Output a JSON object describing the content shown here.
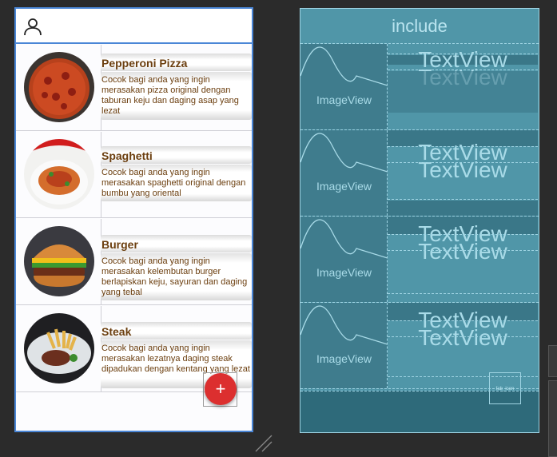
{
  "foods": [
    {
      "title": "Pepperoni Pizza",
      "desc": "Cocok bagi anda yang ingin merasakan pizza original dengan taburan keju dan daging asap yang lezat"
    },
    {
      "title": "Spaghetti",
      "desc": "Cocok bagi anda yang ingin merasakan spaghetti original dengan bumbu yang oriental"
    },
    {
      "title": "Burger",
      "desc": "Cocok bagi anda yang ingin merasakan kelembutan burger berlapiskan keju, sayuran dan daging yang tebal"
    },
    {
      "title": "Steak",
      "desc": "Cocok bagi anda yang ingin merasakan lezatnya daging steak dipadukan dengan kentang yang lezat"
    }
  ],
  "fab": {
    "symbol": "+"
  },
  "blueprint": {
    "include_label": "include",
    "image_label": "ImageView",
    "text_label": "TextView",
    "fab_label": "fab_icon"
  },
  "colors": {
    "accent": "#4a86d6",
    "text": "#6b3e0e",
    "fab": "#dc2f2f",
    "blueprint": "#5096a8"
  }
}
